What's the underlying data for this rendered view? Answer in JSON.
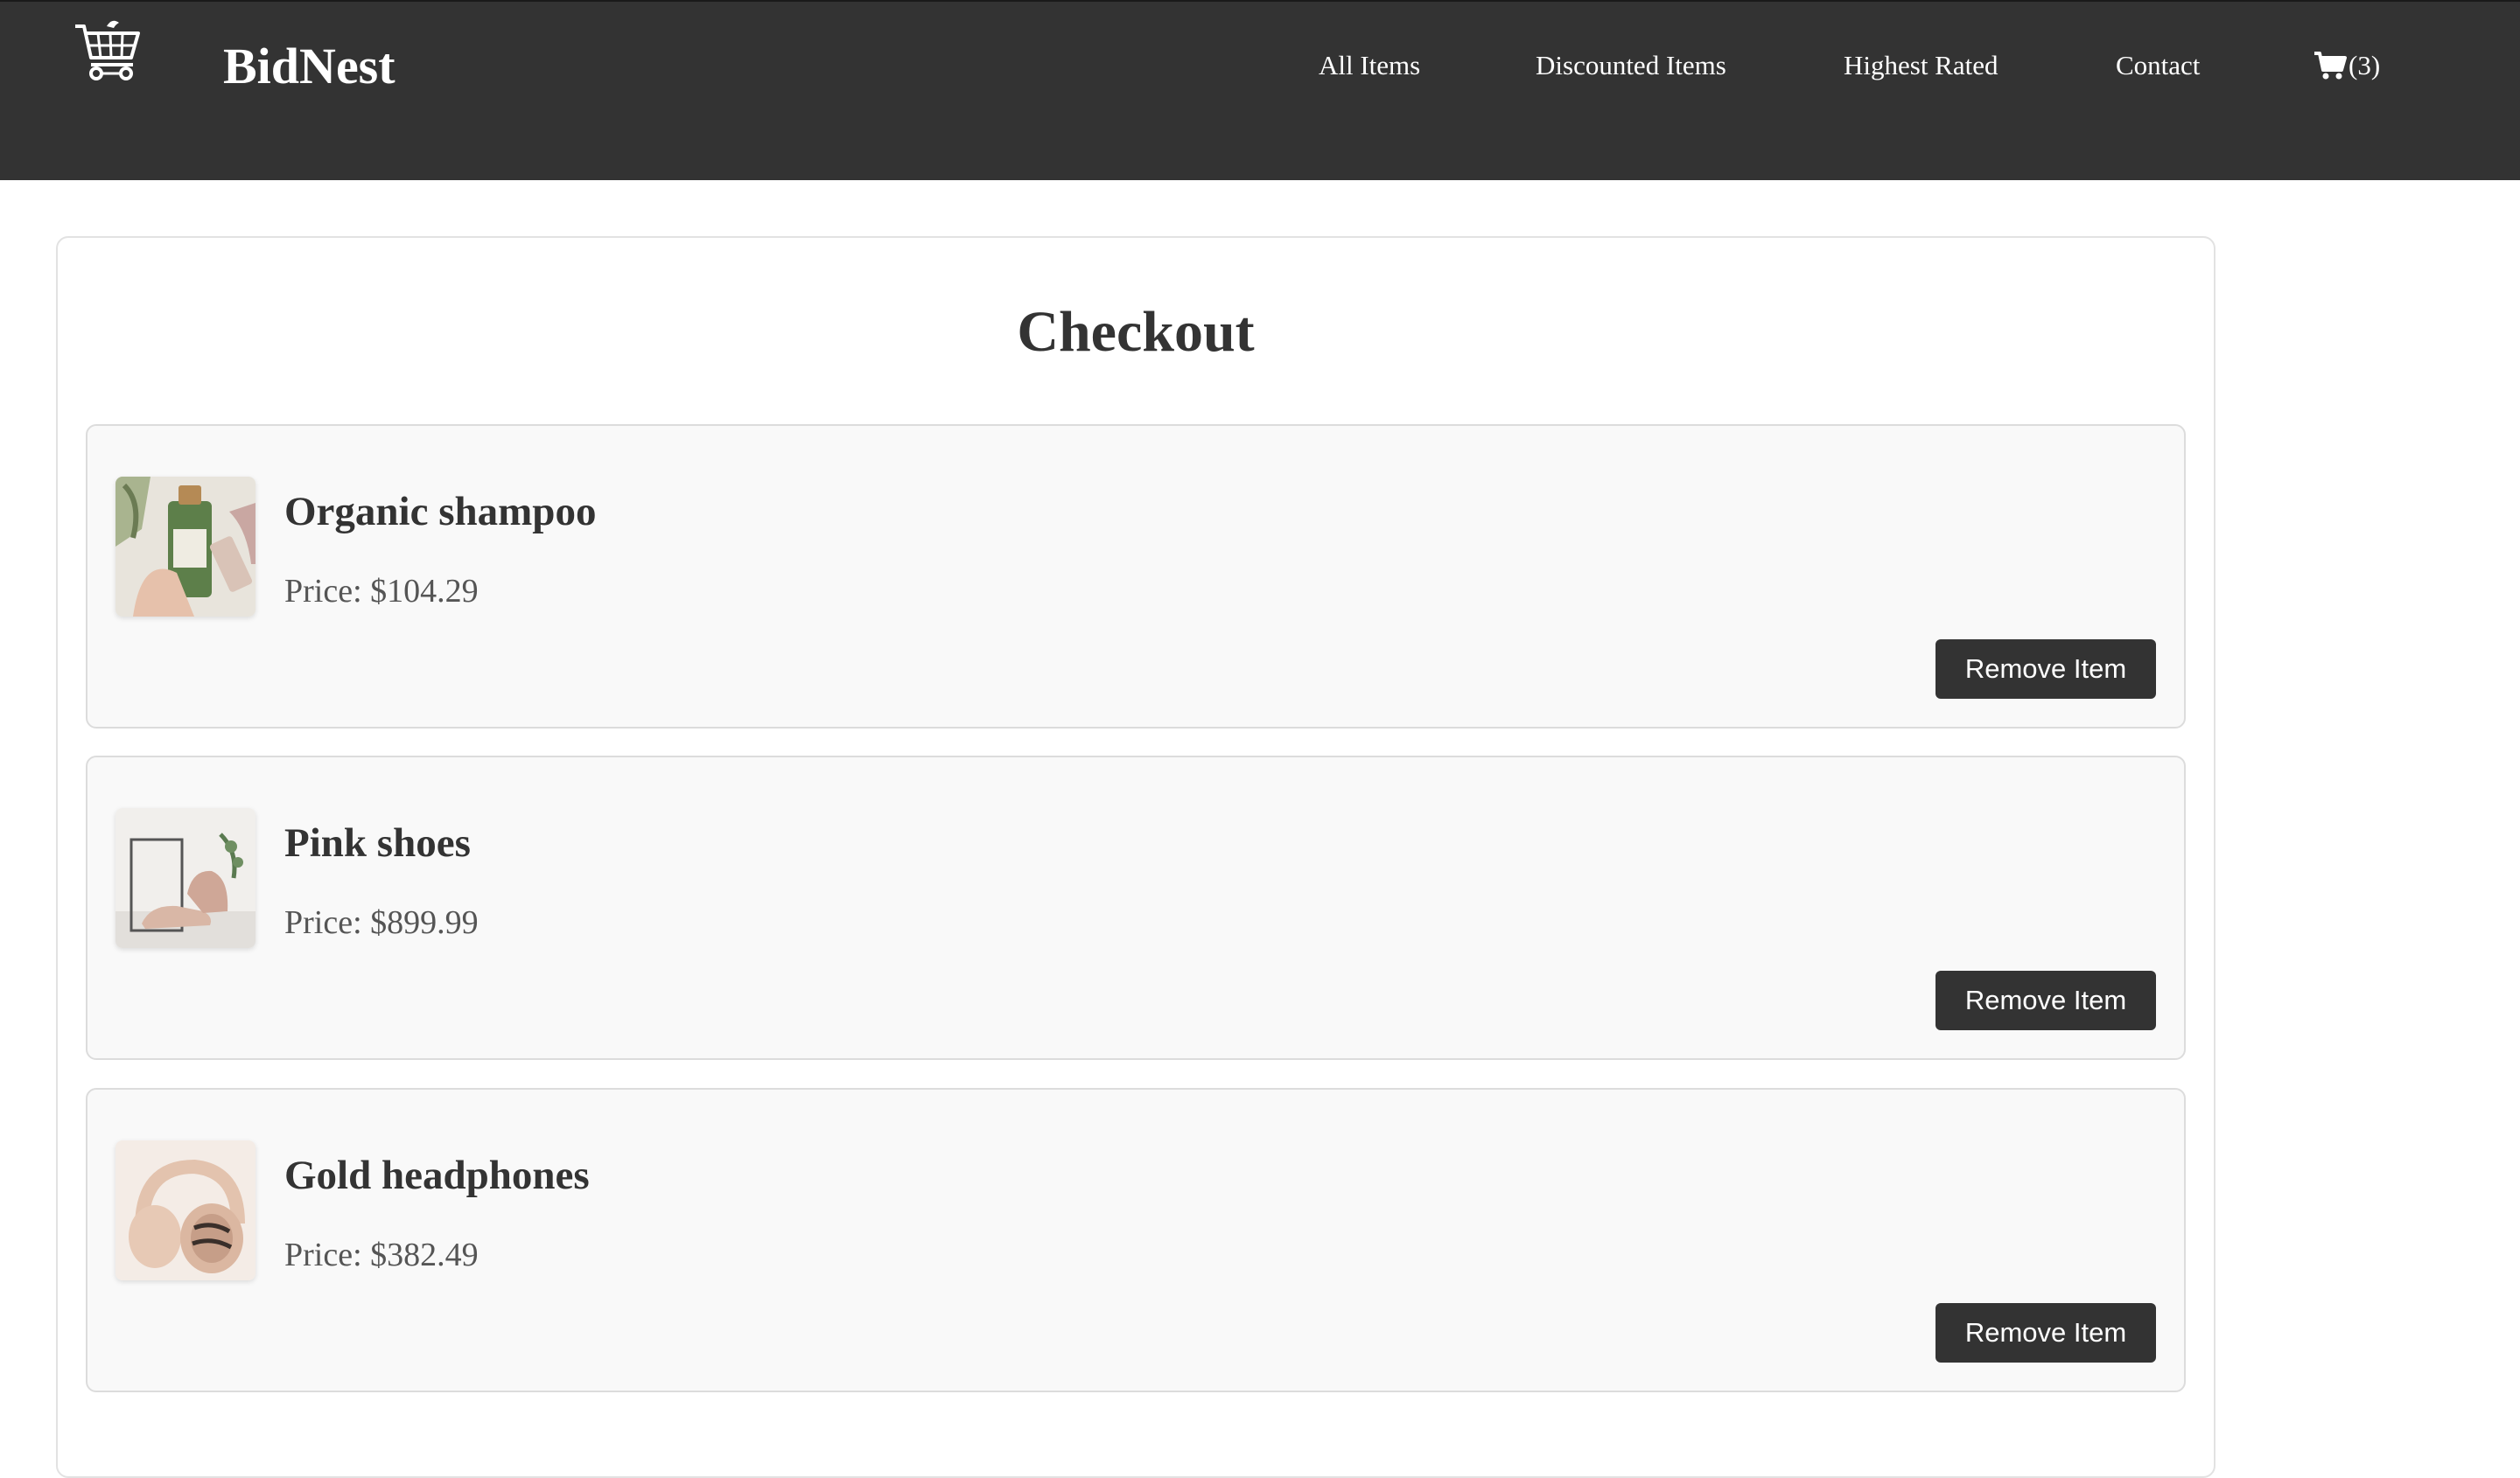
{
  "header": {
    "brand": "BidNest",
    "logo_icon": "shopping-cart-logo-icon",
    "nav": {
      "all_items": "All Items",
      "discounted_items": "Discounted Items",
      "highest_rated": "Highest Rated",
      "contact": "Contact",
      "cart_icon": "cart-icon",
      "cart_count": "(3)"
    }
  },
  "checkout": {
    "title": "Checkout",
    "items": [
      {
        "name": "Organic shampoo",
        "price": "Price: $104.29",
        "image": "shampoo-bottle-photo",
        "remove_label": "Remove Item"
      },
      {
        "name": "Pink shoes",
        "price": "Price: $899.99",
        "image": "pink-sneakers-photo",
        "remove_label": "Remove Item"
      },
      {
        "name": "Gold headphones",
        "price": "Price: $382.49",
        "image": "gold-headphones-photo",
        "remove_label": "Remove Item"
      }
    ]
  },
  "colors": {
    "nav_background": "#333333",
    "nav_text": "#ffffff",
    "card_background": "#f9f9f9",
    "button_background": "#333333",
    "button_text": "#ffffff",
    "heading_text": "#333333",
    "price_text": "#555555"
  }
}
